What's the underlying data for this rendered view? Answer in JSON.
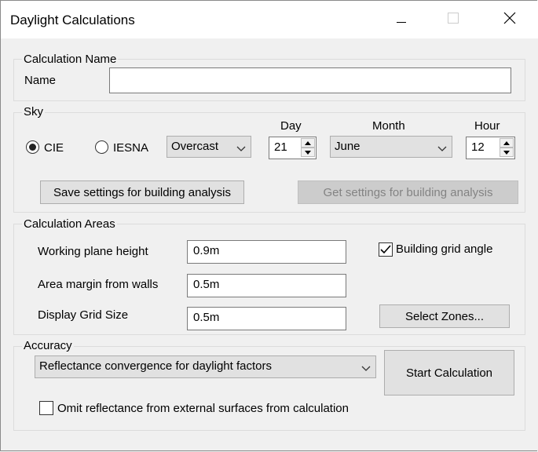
{
  "window": {
    "title": "Daylight Calculations"
  },
  "calculation_name": {
    "legend": "Calculation Name",
    "name_label": "Name",
    "name_value": ""
  },
  "sky": {
    "legend": "Sky",
    "cie_label": "CIE",
    "iesna_label": "IESNA",
    "selected_model": "CIE",
    "condition": "Overcast",
    "day_label": "Day",
    "day_value": "21",
    "month_label": "Month",
    "month_value": "June",
    "hour_label": "Hour",
    "hour_value": "12",
    "save_button": "Save settings for building analysis",
    "get_button": "Get settings for building analysis"
  },
  "areas": {
    "legend": "Calculation Areas",
    "working_plane_label": "Working plane height",
    "working_plane_value": "0.9m",
    "area_margin_label": "Area margin from walls",
    "area_margin_value": "0.5m",
    "grid_size_label": "Display Grid Size",
    "grid_size_value": "0.5m",
    "grid_angle_label": "Building grid angle",
    "grid_angle_checked": true,
    "select_zones_button": "Select Zones..."
  },
  "accuracy": {
    "legend": "Accuracy",
    "selected": "Reflectance convergence for daylight factors",
    "start_button": "Start Calculation",
    "omit_label": "Omit reflectance from external surfaces from calculation",
    "omit_checked": false
  }
}
